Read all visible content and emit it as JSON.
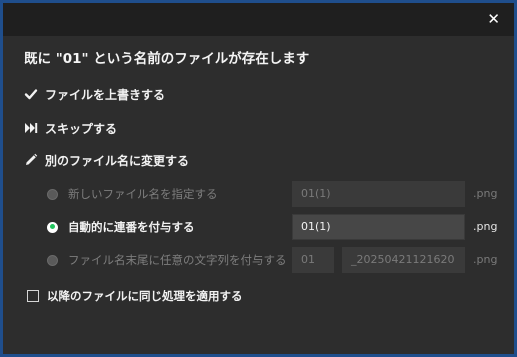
{
  "dialog": {
    "close_glyph": "✕",
    "heading": "既に \"01\" という名前のファイルが存在します"
  },
  "actions": {
    "overwrite": {
      "icon": "check-icon",
      "label": "ファイルを上書きする"
    },
    "skip": {
      "icon": "skip-forward-icon",
      "label": "スキップする"
    },
    "rename": {
      "icon": "pencil-icon",
      "label": "別のファイル名に変更する"
    }
  },
  "rename_options": [
    {
      "label": "新しいファイル名を指定する",
      "selected": false,
      "value": "01(1)",
      "ext": ".png"
    },
    {
      "label": "自動的に連番を付与する",
      "selected": true,
      "value": "01(1)",
      "ext": ".png"
    },
    {
      "label": "ファイル名末尾に任意の文字列を付与する",
      "selected": false,
      "value": "01",
      "suffix": "_20250421121620",
      "ext": ".png"
    }
  ],
  "apply_all": {
    "label": "以降のファイルに同じ処理を適用する",
    "checked": false
  },
  "colors": {
    "accent_border": "#1f4e8c",
    "radio_selected": "#22c55e",
    "titlebar": "#1f1f1f",
    "body": "#2d2d2d"
  }
}
